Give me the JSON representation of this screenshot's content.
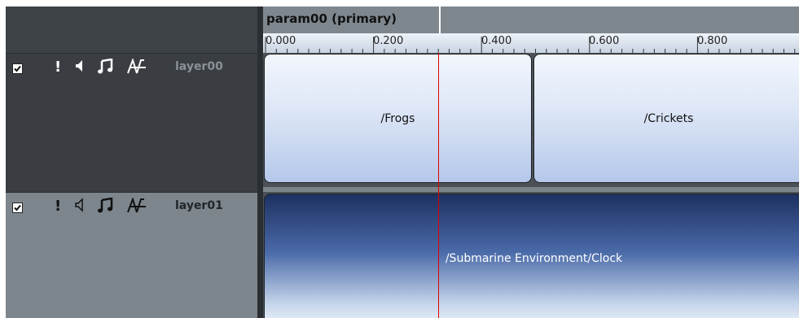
{
  "window": {
    "param_title": "param00 (primary)"
  },
  "ruler": {
    "ticks": [
      "0.000",
      "0.200",
      "0.400",
      "0.600",
      "0.800"
    ]
  },
  "layers": [
    {
      "name": "layer00",
      "checked": true,
      "icons": [
        "!",
        "speaker-icon",
        "music-note-icon",
        "waveform-icon"
      ]
    },
    {
      "name": "layer01",
      "checked": true,
      "icons": [
        "!",
        "speaker-icon",
        "music-note-icon",
        "waveform-icon"
      ]
    }
  ],
  "clips": {
    "frogs": "/Frogs",
    "crickets": "/Crickets",
    "clock": "/Submarine Environment/Clock"
  },
  "playhead_position": 0.325,
  "colors": {
    "playhead": "#e00000",
    "clip_light": "#dfe8f7",
    "clip_dark": "#1d3161"
  }
}
